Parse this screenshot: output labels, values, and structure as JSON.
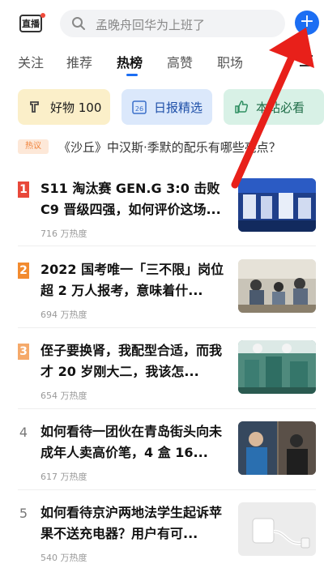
{
  "header": {
    "live_label": "直播",
    "search_placeholder": "孟晚舟回华为上班了",
    "plus_label": "+"
  },
  "tabs": [
    {
      "label": "关注"
    },
    {
      "label": "推荐"
    },
    {
      "label": "热榜",
      "active": true
    },
    {
      "label": "高赞"
    },
    {
      "label": "职场"
    }
  ],
  "cards": [
    {
      "label": "好物 100",
      "icon": "tag-icon",
      "color": "#fbefc9"
    },
    {
      "label": "日报精选",
      "icon": "calendar-icon",
      "color": "#dbe8fb"
    },
    {
      "label": "本站必看",
      "icon": "thumb-up-icon",
      "color": "#d8f1e6"
    }
  ],
  "hot_strip": {
    "tag": "热议",
    "text": "《沙丘》中汉斯·季默的配乐有哪些亮点？"
  },
  "list": [
    {
      "rank": "1",
      "title": "S11 淘汰赛 GEN.G 3:0 击败 C9 晋级四强，如何评价这场...",
      "heat": "716 万热度"
    },
    {
      "rank": "2",
      "title": "2022 国考唯一「三不限」岗位超 2 万人报考，意味着什...",
      "heat": "694 万热度"
    },
    {
      "rank": "3",
      "title": "侄子要换肾，我配型合适，而我才 20 岁刚大二，我该怎...",
      "heat": "654 万热度"
    },
    {
      "rank": "4",
      "title": "如何看待一团伙在青岛街头向未成年人卖高价笔，4 盒 16...",
      "heat": "617 万热度"
    },
    {
      "rank": "5",
      "title": "如何看待京沪两地法学生起诉苹果不送充电器？用户有可...",
      "heat": "540 万热度"
    }
  ],
  "colors": {
    "accent": "#1c6ef3",
    "rank1": "#e8483a",
    "rank2": "#f28b2f",
    "rank3": "#f5a96a",
    "annotation_arrow": "#e8201a"
  }
}
